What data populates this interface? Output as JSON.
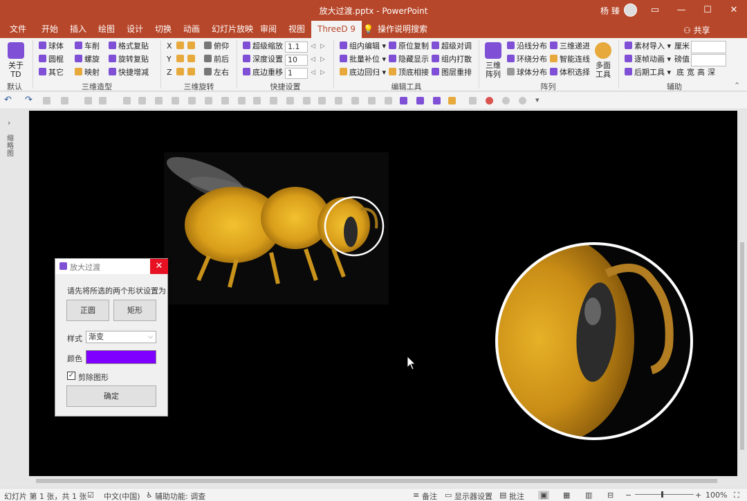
{
  "titlebar": {
    "title": "放大过渡.pptx - PowerPoint",
    "user": "杨 臻",
    "controls": {
      "ribbon_toggle": "▭",
      "minimize": "—",
      "maximize": "☐",
      "close": "✕"
    }
  },
  "tabs": [
    "文件",
    "开始",
    "插入",
    "绘图",
    "设计",
    "切换",
    "动画",
    "幻灯片放映",
    "审阅",
    "视图",
    "ThreeD 9"
  ],
  "tell_me": "操作说明搜索",
  "share": "共享",
  "ribbon": {
    "about": {
      "label1": "关于",
      "label2": "TD"
    },
    "default_group": "默认",
    "shapes_group": {
      "label": "三维造型",
      "items": [
        "球体",
        "车削",
        "格式复贴",
        "圆棍",
        "螺旋",
        "旋转复贴",
        "其它",
        "映射",
        "快捷增减"
      ]
    },
    "rotate_group": {
      "label": "三维旋转",
      "axes": [
        "X",
        "Y",
        "Z"
      ],
      "items": [
        "俯仰",
        "前后",
        "左右"
      ]
    },
    "quick_group": {
      "label": "快捷设置",
      "items": [
        "超级缩放",
        "深度设置",
        "底边重移"
      ],
      "values": [
        "1.1",
        "10",
        "1"
      ]
    },
    "edit_group": {
      "label": "编辑工具",
      "items": [
        "组内编辑",
        "原位复制",
        "超级对调",
        "批量补位",
        "隐藏显示",
        "组内打散",
        "底边回归",
        "顶底相接",
        "图层重排"
      ]
    },
    "array_group": {
      "label": "阵列",
      "big1": [
        "三维",
        "阵列"
      ],
      "big2": [
        "多面",
        "工具"
      ],
      "items": [
        "沿线分布",
        "三维递进",
        "环绕分布",
        "智能连线",
        "球体分布",
        "体积选择"
      ]
    },
    "aux_group": {
      "label": "辅助",
      "items": [
        "素材导入",
        "逐帧动画",
        "后期工具"
      ],
      "unit_labels": [
        "厘米",
        "磅值"
      ],
      "bottom": [
        "底",
        "宽",
        "高",
        "深"
      ]
    }
  },
  "left_pane": {
    "label": "缩略图"
  },
  "dialog": {
    "title": "放大过渡",
    "close": "✕",
    "instruction": "请先将所选的两个形状设置为",
    "btn_circle": "正圆",
    "btn_rect": "矩形",
    "style_label": "样式",
    "style_value": "渐变",
    "color_label": "颜色",
    "color_value": "#8000ff",
    "checkbox_label": "剪除图形",
    "checkbox_checked": "✓",
    "ok": "确定"
  },
  "status": {
    "slide": "幻灯片 第 1 张，共 1 张",
    "language": "中文(中国)",
    "accessibility": "辅助功能: 调查",
    "notes": "备注",
    "display": "显示器设置",
    "comments": "批注",
    "zoom": "100%"
  },
  "colors": {
    "accent": "#b7472a",
    "ribbon": "#f3f3f3",
    "purple": "#7f4fd6"
  }
}
